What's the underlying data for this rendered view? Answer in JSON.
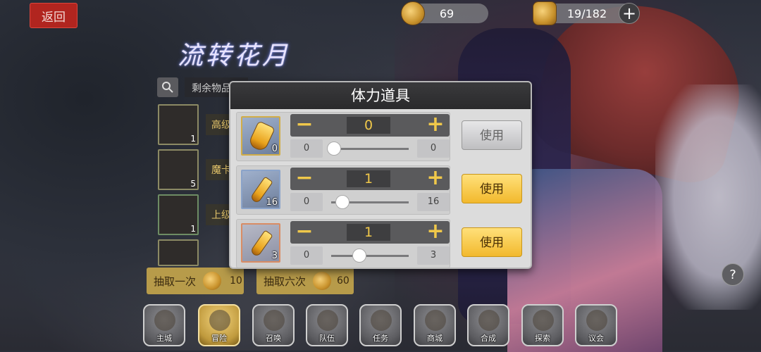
{
  "top": {
    "back_label": "返回",
    "coins": "69",
    "stamina": "19/182",
    "plus_symbol": "+"
  },
  "logo_text": "流转花月",
  "search": {
    "label": "剩余物品"
  },
  "items": [
    {
      "count": "1",
      "name": "高级"
    },
    {
      "count": "5",
      "name": "魔卡"
    },
    {
      "count": "1",
      "name": "上级"
    }
  ],
  "draw": [
    {
      "label": "抽取一次",
      "cost": "10"
    },
    {
      "label": "抽取六次",
      "cost": "60"
    }
  ],
  "nav": [
    {
      "label": "主城",
      "icon": "castle-icon"
    },
    {
      "label": "冒险",
      "icon": "axe-icon"
    },
    {
      "label": "召唤",
      "icon": "card-summon-icon"
    },
    {
      "label": "队伍",
      "icon": "team-crest-icon"
    },
    {
      "label": "任务",
      "icon": "quest-map-icon"
    },
    {
      "label": "商城",
      "icon": "shop-icon"
    },
    {
      "label": "合成",
      "icon": "crystal-forge-icon"
    },
    {
      "label": "探索",
      "icon": "compass-icon"
    },
    {
      "label": "议会",
      "icon": "council-crown-icon"
    }
  ],
  "help_symbol": "?",
  "modal": {
    "title": "体力道具",
    "minus_symbol": "−",
    "plus_symbol": "+",
    "rows": [
      {
        "qty": "0",
        "value": "0",
        "min": "0",
        "max": "0",
        "use_label": "使用",
        "enabled": false
      },
      {
        "qty": "16",
        "value": "1",
        "min": "0",
        "max": "16",
        "use_label": "使用",
        "enabled": true
      },
      {
        "qty": "3",
        "value": "1",
        "min": "0",
        "max": "3",
        "use_label": "使用",
        "enabled": true
      }
    ]
  },
  "colors": {
    "accent_gold": "#f0c84a",
    "back_red": "#b1251f",
    "use_yellow": "#f2b92d"
  }
}
